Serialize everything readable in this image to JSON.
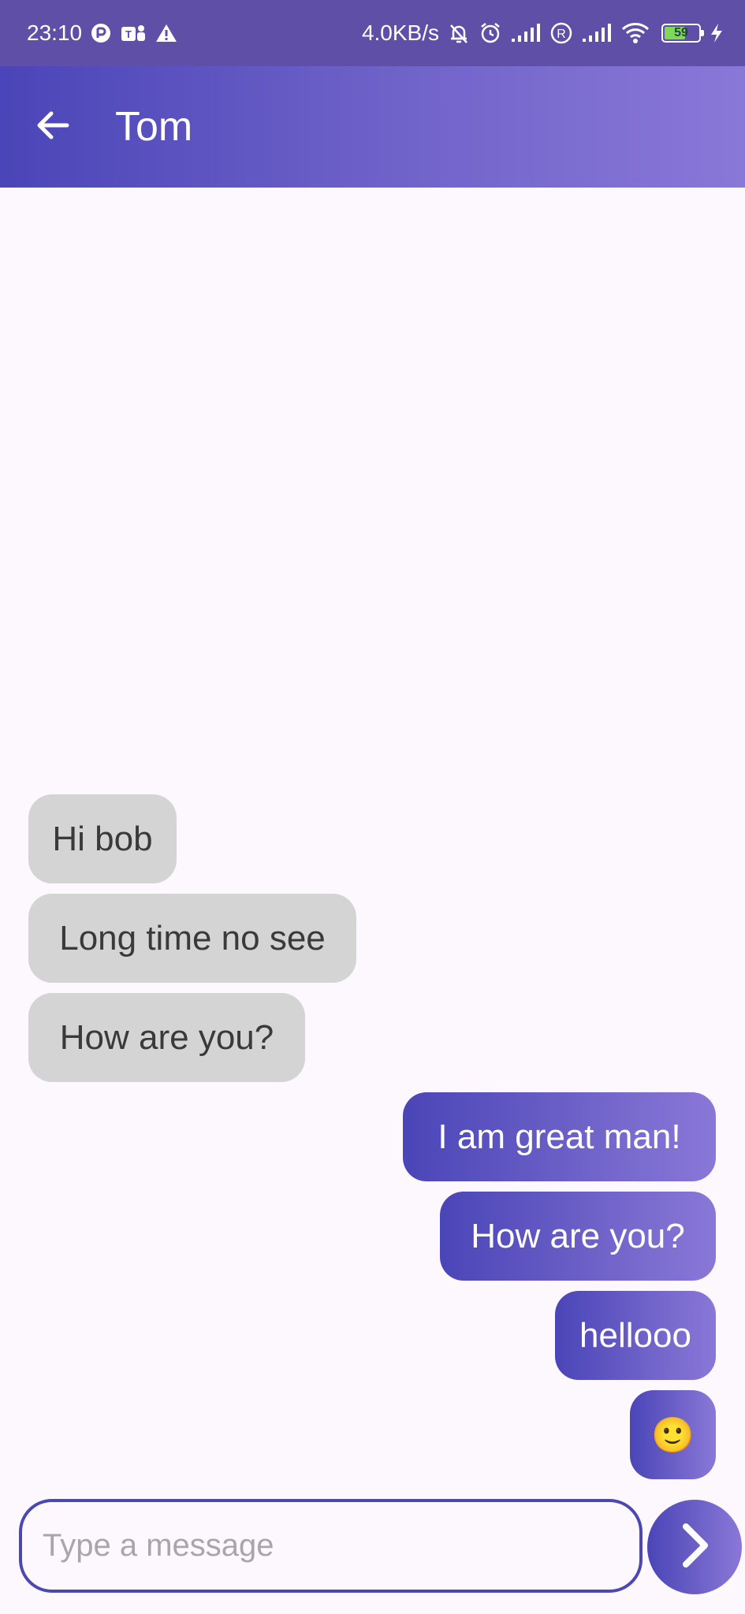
{
  "status_bar": {
    "time": "23:10",
    "net_speed": "4.0KB/s",
    "battery_level": "59",
    "icons_left": [
      "notification-dot-icon",
      "teams-icon",
      "warning-icon"
    ],
    "icons_right": [
      "bell-off-icon",
      "alarm-icon",
      "signal-icon",
      "roaming-icon",
      "signal-icon",
      "wifi-icon",
      "battery-icon",
      "charging-icon"
    ]
  },
  "header": {
    "title": "Tom",
    "back_icon": "arrow-left-icon"
  },
  "messages": [
    {
      "text": "Hi bob",
      "direction": "incoming"
    },
    {
      "text": "Long time no see",
      "direction": "incoming"
    },
    {
      "text": "How are you?",
      "direction": "incoming"
    },
    {
      "text": "I am great man!",
      "direction": "outgoing"
    },
    {
      "text": "How are you?",
      "direction": "outgoing"
    },
    {
      "text": "hellooo",
      "direction": "outgoing"
    },
    {
      "text": "🙂",
      "direction": "outgoing"
    }
  ],
  "composer": {
    "placeholder": "Type a message",
    "value": "",
    "send_icon": "chevron-right-icon"
  },
  "colors": {
    "status_bar": "#5f4fa6",
    "accent_start": "#4a45b8",
    "accent_end": "#8a78d8",
    "incoming_bubble": "#d4d4d4",
    "background": "#fdf8fd"
  }
}
